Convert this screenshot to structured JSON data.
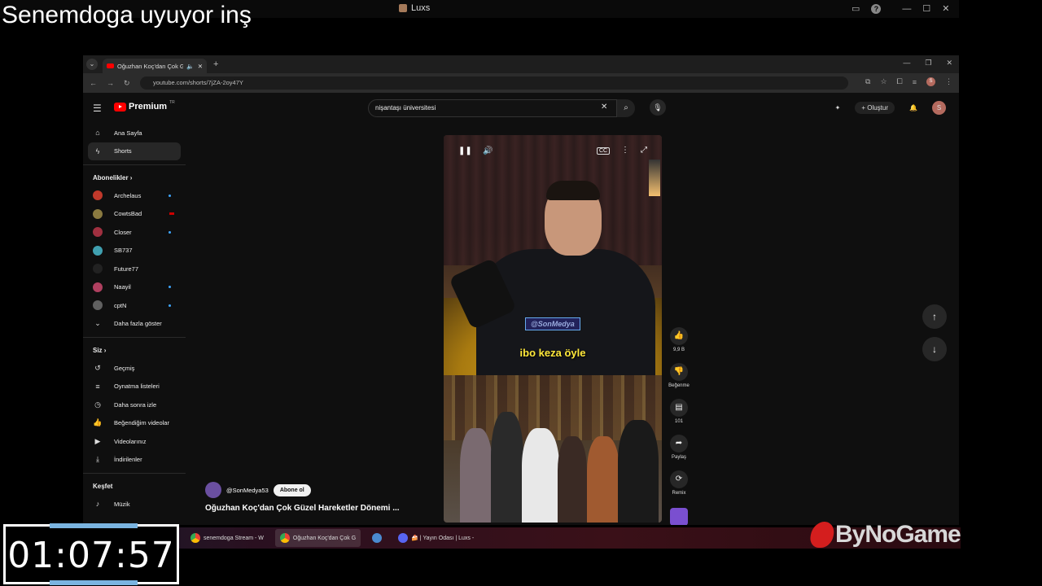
{
  "overlay": {
    "stream_caption": "Senemdoga uyuyor inş",
    "window_title": "Luxs",
    "timer": "01:07:57",
    "brand": "ByNoGame"
  },
  "browser": {
    "tab_title": "Oğuzhan Koç'dan Çok Güzel",
    "url": "youtube.com/shorts/7jZA-2oy47Y"
  },
  "youtube": {
    "logo_text": "Premium",
    "logo_region": "TR",
    "search_value": "nişantaşı üniversitesi",
    "create_label": "Oluştur",
    "avatar_letter": "S"
  },
  "sidebar": {
    "main": [
      {
        "label": "Ana Sayfa",
        "icon": "home-icon"
      },
      {
        "label": "Shorts",
        "icon": "shorts-icon"
      }
    ],
    "subscriptions_heading": "Abonelikler",
    "subscriptions": [
      {
        "label": "Archelaus",
        "color": "#c0392b",
        "indicator": "dot"
      },
      {
        "label": "CowtsBad",
        "color": "#8a7a40",
        "indicator": "live"
      },
      {
        "label": "Closer",
        "color": "#a03040",
        "indicator": "dot"
      },
      {
        "label": "SB737",
        "color": "#40a0b0",
        "indicator": ""
      },
      {
        "label": "Future77",
        "color": "#222222",
        "indicator": ""
      },
      {
        "label": "Naayil",
        "color": "#b04060",
        "indicator": "dot"
      },
      {
        "label": "cptN",
        "color": "#606060",
        "indicator": "dot"
      }
    ],
    "show_more": "Daha fazla göster",
    "you_heading": "Siz",
    "you_items": [
      {
        "label": "Geçmiş",
        "icon": "history-icon"
      },
      {
        "label": "Oynatma listeleri",
        "icon": "playlist-icon"
      },
      {
        "label": "Daha sonra izle",
        "icon": "clock-icon"
      },
      {
        "label": "Beğendiğim videolar",
        "icon": "thumb-up-icon"
      },
      {
        "label": "Videolarınız",
        "icon": "video-icon"
      },
      {
        "label": "İndirilenler",
        "icon": "download-icon"
      }
    ],
    "explore_heading": "Keşfet",
    "explore_items": [
      {
        "label": "Müzik",
        "icon": "music-icon"
      }
    ]
  },
  "short": {
    "watermark": "@SonMedya",
    "subtitle": "ibo keza öyle",
    "channel": "@SonMedya53",
    "subscribe_label": "Abone ol",
    "title": "Oğuzhan Koç'dan Çok Güzel Hareketler Dönemi ..."
  },
  "actions": {
    "likes": "9,9 B",
    "dislike_label": "Beğenme",
    "comments": "101",
    "share_label": "Paylaş",
    "remix_label": "Remix"
  },
  "taskbar": {
    "apps": [
      {
        "label": "senemdoga Stream - W",
        "icon": "chrome-icon"
      },
      {
        "label": "Oğuzhan Koç'dan Çok G",
        "icon": "chrome-icon"
      },
      {
        "label": "",
        "icon": "gear-icon"
      },
      {
        "label": "🍰 | Yayın Odası | Luxs -",
        "icon": "discord-icon"
      }
    ]
  }
}
